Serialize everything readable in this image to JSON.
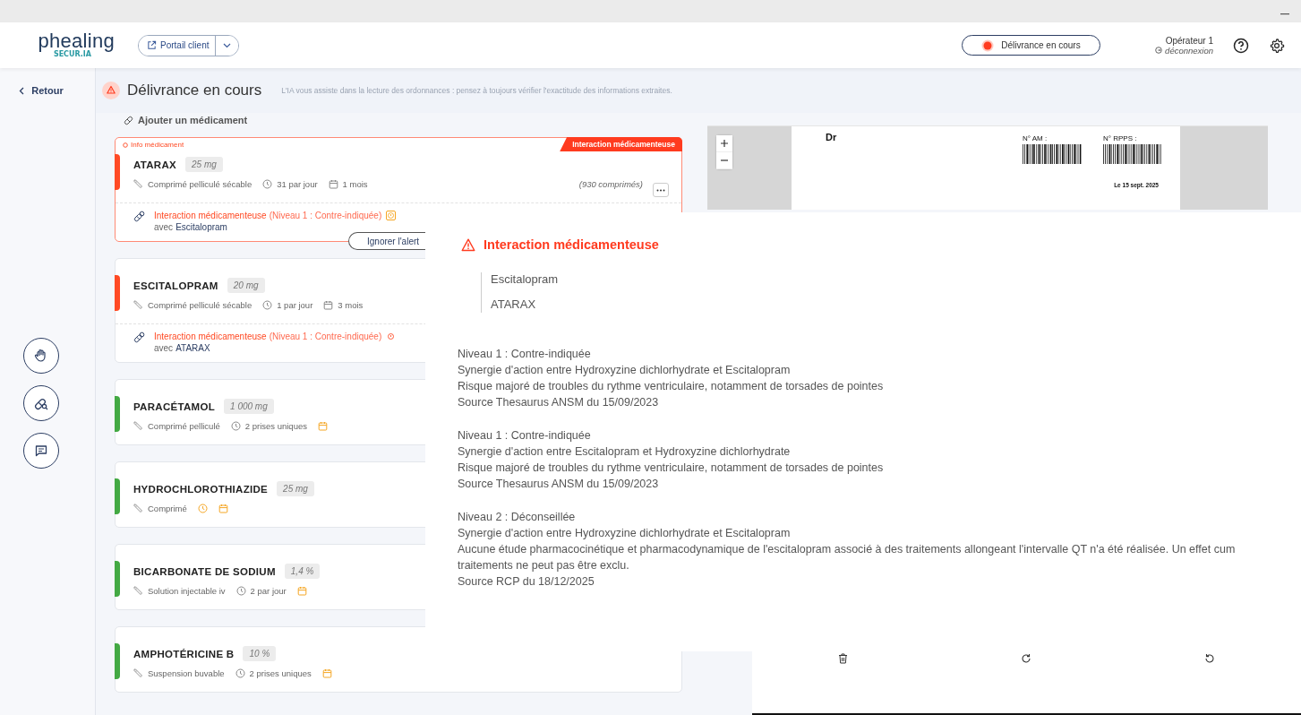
{
  "header": {
    "logo": "phealing",
    "logo_tagline": "SECUR.IA",
    "portal_button": "Portail client",
    "status_pill": "Délivrance en cours",
    "operator": "Opérateur 1",
    "logout": "déconnexion"
  },
  "page": {
    "back": "Retour",
    "title": "Délivrance en cours",
    "banner": "L'IA vous assiste dans la lecture des ordonnances : pensez à toujours vérifier l'exactitude des informations extraites."
  },
  "add_medication": "Ajouter un médicament",
  "medications": [
    {
      "name": "ATARAX",
      "dose": "25 mg",
      "color": "#ff4a24",
      "info_label": "Info médicament",
      "tag": "Interaction médicamenteuse",
      "form": "Comprimé pelliculé sécable",
      "frequency": "31 par jour",
      "duration": "1 mois",
      "quantity": "(930 comprimés)",
      "interaction": {
        "title": "Interaction médicamenteuse",
        "level": "(Niveau 1 : Contre-indiquée)",
        "with_label": "avec",
        "with": "Escitalopram",
        "highlighted": true
      },
      "dismiss_button": "Ignorer l'alert"
    },
    {
      "name": "ESCITALOPRAM",
      "dose": "20 mg",
      "color": "#ff4a24",
      "form": "Comprimé pelliculé sécable",
      "frequency": "1 par jour",
      "duration": "3 mois",
      "interaction": {
        "title": "Interaction médicamenteuse",
        "level": "(Niveau 1 : Contre-indiquée)",
        "with_label": "avec",
        "with": "ATARAX",
        "highlighted": false
      }
    },
    {
      "name": "PARACÉTAMOL",
      "dose": "1 000 mg",
      "color": "#43a943",
      "form": "Comprimé pelliculé",
      "frequency": "2 prises uniques"
    },
    {
      "name": "HYDROCHLOROTHIAZIDE",
      "dose": "25 mg",
      "color": "#43a943",
      "form": "Comprimé"
    },
    {
      "name": "BICARBONATE DE SODIUM",
      "dose": "1,4 %",
      "color": "#43a943",
      "form": "Solution injectable iv",
      "frequency": "2 par jour"
    },
    {
      "name": "AMPHOTÉRICINE B",
      "dose": "10 %",
      "color": "#43a943",
      "form": "Suspension buvable",
      "frequency": "2 prises uniques"
    }
  ],
  "prescription": {
    "doctor": "Dr",
    "am_label": "N° AM :",
    "rpps_label": "N° RPPS :",
    "date": "Le 15 sept. 2025"
  },
  "interaction_popup": {
    "title": "Interaction médicamenteuse",
    "drugs": [
      "Escitalopram",
      "ATARAX"
    ],
    "entries": [
      {
        "lines": [
          "Niveau 1 : Contre-indiquée",
          "Synergie d'action entre Hydroxyzine dichlorhydrate et Escitalopram",
          "Risque majoré de troubles du rythme ventriculaire, notamment de torsades de pointes",
          "Source Thesaurus ANSM du 15/09/2023"
        ]
      },
      {
        "lines": [
          "Niveau 1 : Contre-indiquée",
          "Synergie d'action entre Escitalopram et Hydroxyzine dichlorhydrate",
          "Risque majoré de troubles du rythme ventriculaire, notamment de torsades de pointes",
          "Source Thesaurus ANSM du 15/09/2023"
        ]
      },
      {
        "lines": [
          "Niveau 2 : Déconseillée",
          "Synergie d'action entre Hydroxyzine dichlorhydrate et Escitalopram",
          "Aucune étude pharmacocinétique et pharmacodynamique de l'escitalopram associé à des traitements allongeant l'intervalle QT n'a été réalisée. Un effet cum",
          "traitements ne peut pas être exclu.",
          "Source RCP du 18/12/2025"
        ]
      }
    ]
  }
}
